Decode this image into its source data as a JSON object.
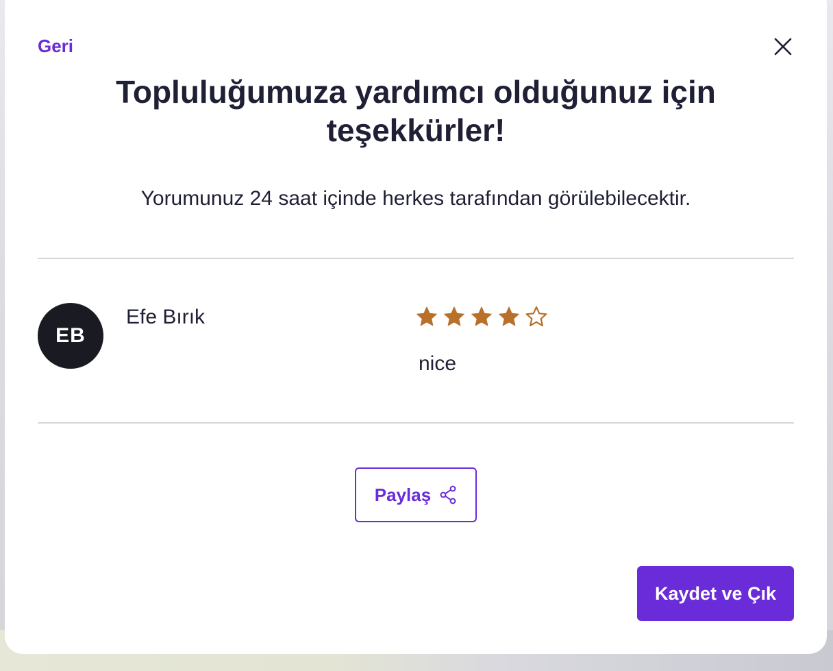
{
  "modal": {
    "back_label": "Geri",
    "close_icon": "close-icon",
    "title": "Topluluğumuza yardımcı olduğunuz için teşekkürler!",
    "subtitle": "Yorumunuz 24 saat içinde herkes tarafından görülebilecektir."
  },
  "review": {
    "avatar_initials": "EB",
    "reviewer_name": "Efe Bırık",
    "rating": 4,
    "rating_max": 5,
    "text": "nice",
    "star_color": "#b8702a"
  },
  "actions": {
    "share_label": "Paylaş",
    "share_icon": "share-icon",
    "save_label": "Kaydet ve Çık"
  },
  "colors": {
    "accent": "#6a2bd8",
    "text": "#1f1f35",
    "avatar_bg": "#1a1a23"
  }
}
